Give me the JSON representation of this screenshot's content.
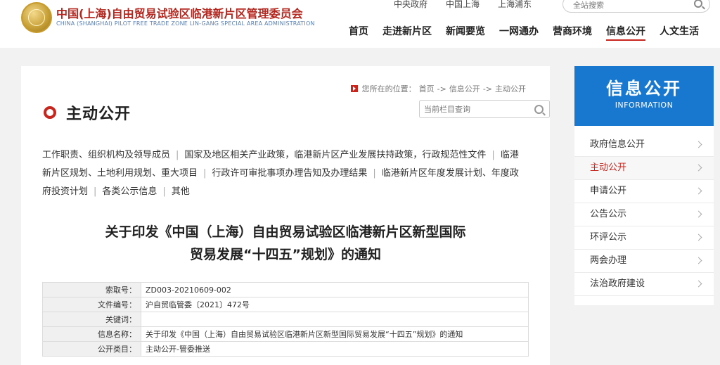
{
  "header": {
    "site_title": "中国(上海)自由贸易试验区临港新片区管理委员会",
    "site_subtitle": "CHINA (SHANGHAI) PILOT FREE TRADE ZONE LIN-GANG SPECIAL AREA ADMINISTRATION",
    "top_links": [
      "中央政府",
      "中国上海",
      "上海浦东"
    ],
    "search_placeholder": "全站搜索",
    "nav": [
      "首页",
      "走进新片区",
      "新闻要览",
      "一网通办",
      "营商环境",
      "信息公开",
      "人文生活"
    ],
    "active_nav": "信息公开"
  },
  "main": {
    "breadcrumb": {
      "prefix": "您所在的位置：",
      "items": [
        "首页",
        "信息公开",
        "主动公开"
      ],
      "separator": "->"
    },
    "panel_title": "主动公开",
    "column_search_placeholder": "当前栏目查询",
    "categories": [
      "工作职责、组织机构及领导成员",
      "国家及地区相关产业政策，临港新片区产业发展扶持政策，行政规范性文件",
      "临港新片区规划、土地利用规划、重大项目",
      "行政许可审批事项办理告知及办理结果",
      "临港新片区年度发展计划、年度政府投资计划",
      "各类公示信息",
      "其他"
    ],
    "doc_title_line1": "关于印发《中国（上海）自由贸易试验区临港新片区新型国际",
    "doc_title_line2": "贸易发展“十四五”规划》的通知",
    "meta": [
      {
        "key": "索取号：",
        "value": "ZD003-20210609-002"
      },
      {
        "key": "文件编号：",
        "value": "沪自贸临管委〔2021〕472号"
      },
      {
        "key": "关键词：",
        "value": ""
      },
      {
        "key": "信息名称：",
        "value": "关于印发《中国（上海）自由贸易试验区临港新片区新型国际贸易发展“十四五”规划》的通知"
      },
      {
        "key": "公开类目：",
        "value": "主动公开-管委推送"
      }
    ]
  },
  "sidebar": {
    "title": "信息公开",
    "subtitle": "INFORMATION",
    "items": [
      "政府信息公开",
      "主动公开",
      "申请公开",
      "公告公示",
      "环评公示",
      "两会办理",
      "法治政府建设"
    ],
    "active_item": "主动公开"
  },
  "colors": {
    "accent_red": "#c7261e",
    "sidebar_blue": "#1878d0",
    "logo_gold": "#c9a23a"
  }
}
